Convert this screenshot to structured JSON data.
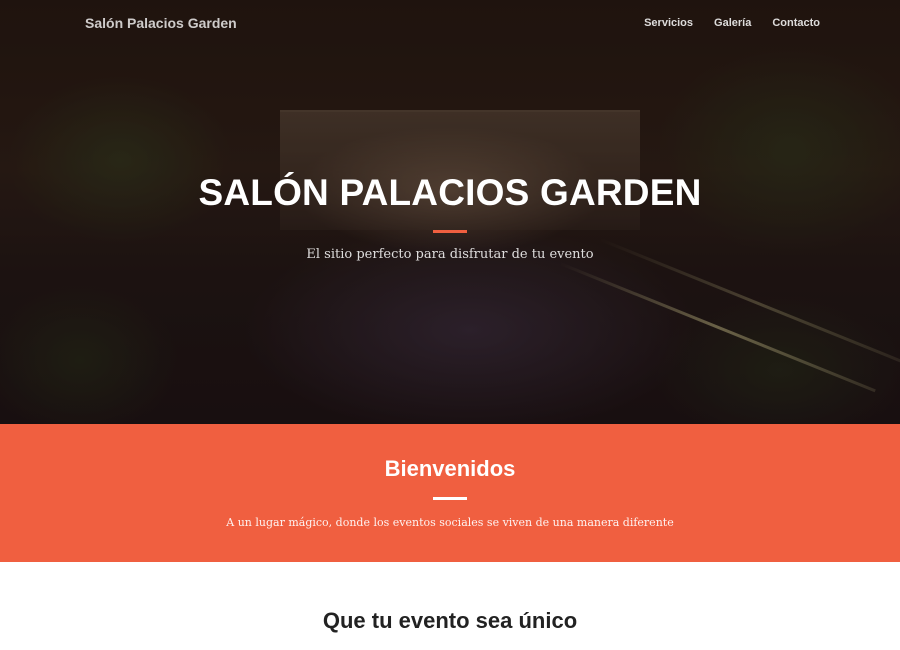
{
  "navbar": {
    "brand": "Salón Palacios Garden",
    "links": [
      {
        "label": "Servicios"
      },
      {
        "label": "Galería"
      },
      {
        "label": "Contacto"
      }
    ]
  },
  "hero": {
    "title": "SALÓN PALACIOS GARDEN",
    "subtitle": "El sitio perfecto para disfrutar de tu evento"
  },
  "welcome": {
    "title": "Bienvenidos",
    "text": "A un lugar mágico, donde los eventos sociales se viven de una manera diferente"
  },
  "services": {
    "title": "Que tu evento sea único"
  },
  "colors": {
    "accent": "#f05f40",
    "white": "#ffffff",
    "heading_dark": "#222222"
  }
}
